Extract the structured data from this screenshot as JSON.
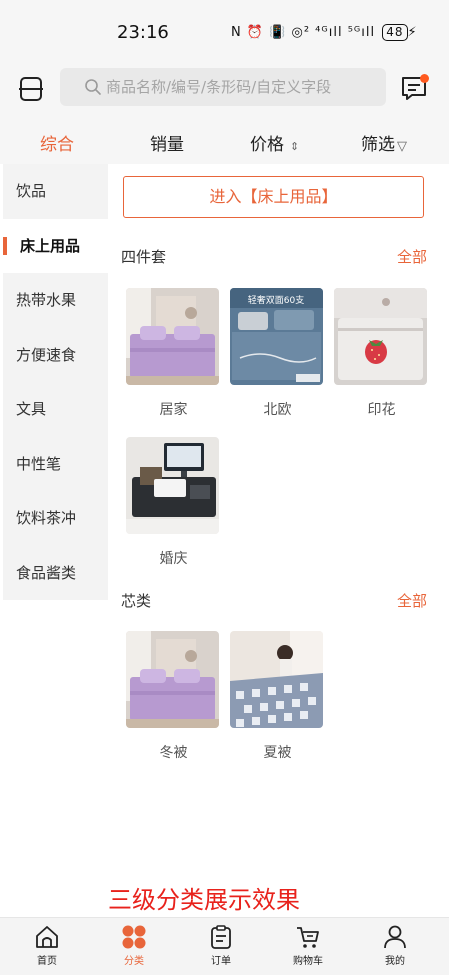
{
  "status_bar": {
    "time": "23:16",
    "signal_icons": "N ⏰ 📳 ◎² ⁴ᴳıll ⁵ᴳıll",
    "battery": "48",
    "charging": "⚡"
  },
  "search": {
    "placeholder": "商品名称/编号/条形码/自定义字段"
  },
  "sort_tabs": [
    {
      "label": "综合",
      "active": true
    },
    {
      "label": "销量"
    },
    {
      "label": "价格",
      "suffix": "⇕"
    },
    {
      "label": "筛选",
      "suffix": "▽"
    }
  ],
  "sidebar": {
    "items": [
      {
        "label": "饮品"
      },
      {
        "label": "床上用品",
        "active": true
      },
      {
        "label": "热带水果"
      },
      {
        "label": "方便速食"
      },
      {
        "label": "文具"
      },
      {
        "label": "中性笔"
      },
      {
        "label": "饮料茶冲"
      },
      {
        "label": "食品酱类"
      }
    ]
  },
  "main": {
    "enter_button": "进入【床上用品】",
    "sections": [
      {
        "title": "四件套",
        "all_label": "全部",
        "items": [
          {
            "label": "居家",
            "image": "purple-bedding"
          },
          {
            "label": "北欧",
            "image": "blue-bedding",
            "overlay_text": "轻奢双面60支"
          },
          {
            "label": "印花",
            "image": "strawberry-bedding"
          },
          {
            "label": "婚庆",
            "image": "cash-register"
          }
        ]
      },
      {
        "title": "芯类",
        "all_label": "全部",
        "items": [
          {
            "label": "冬被",
            "image": "purple-bedding"
          },
          {
            "label": "夏被",
            "image": "blue-check-quilt"
          }
        ]
      }
    ]
  },
  "caption": "三级分类展示效果",
  "tabbar": {
    "items": [
      {
        "label": "首页",
        "icon": "home-icon"
      },
      {
        "label": "分类",
        "icon": "category-icon",
        "active": true
      },
      {
        "label": "订单",
        "icon": "order-icon"
      },
      {
        "label": "购物车",
        "icon": "cart-icon"
      },
      {
        "label": "我的",
        "icon": "user-icon"
      }
    ]
  },
  "colors": {
    "accent": "#e8653a",
    "caption_red": "#e8221c",
    "sidebar_bg": "#f3f3f3"
  }
}
